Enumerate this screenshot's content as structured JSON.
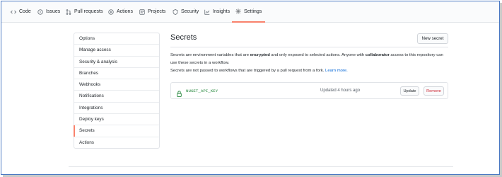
{
  "repo_nav": {
    "tabs": [
      {
        "label": "Code",
        "icon": "code-icon"
      },
      {
        "label": "Issues",
        "icon": "issues-icon"
      },
      {
        "label": "Pull requests",
        "icon": "pull-request-icon"
      },
      {
        "label": "Actions",
        "icon": "actions-icon"
      },
      {
        "label": "Projects",
        "icon": "projects-icon"
      },
      {
        "label": "Security",
        "icon": "shield-icon"
      },
      {
        "label": "Insights",
        "icon": "graph-icon"
      },
      {
        "label": "Settings",
        "icon": "gear-icon"
      }
    ],
    "active": "Settings"
  },
  "sidebar": {
    "items": [
      {
        "label": "Options"
      },
      {
        "label": "Manage access"
      },
      {
        "label": "Security & analysis"
      },
      {
        "label": "Branches"
      },
      {
        "label": "Webhooks"
      },
      {
        "label": "Notifications"
      },
      {
        "label": "Integrations"
      },
      {
        "label": "Deploy keys"
      },
      {
        "label": "Secrets"
      },
      {
        "label": "Actions"
      }
    ],
    "selected": "Secrets"
  },
  "main": {
    "title": "Secrets",
    "new_secret_label": "New secret",
    "description": {
      "part1": "Secrets are environment variables that are ",
      "bold1": "encrypted",
      "part2": " and only exposed to selected actions. Anyone with ",
      "bold2": "collaborator",
      "part3": " access to this repository can use these secrets in a workflow."
    },
    "note": "Secrets are not passed to workflows that are triggered by a pull request from a fork.",
    "learn_more": "Learn more.",
    "secrets": [
      {
        "name": "NUGET_API_KEY",
        "updated": "Updated 4 hours ago",
        "update_label": "Update",
        "remove_label": "Remove"
      }
    ]
  },
  "colors": {
    "accent": "#f9826c",
    "link": "#0366d6",
    "secret_name": "#22863a",
    "danger": "#cb2431"
  }
}
